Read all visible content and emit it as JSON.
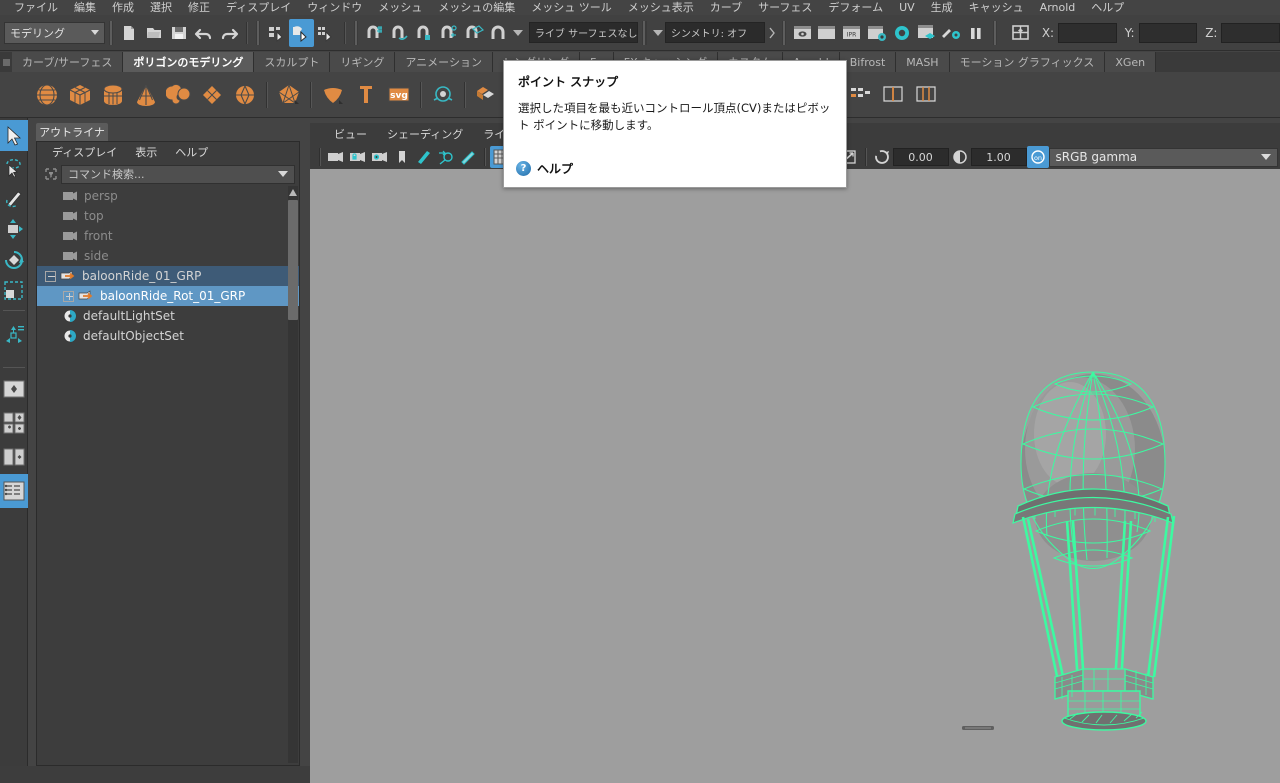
{
  "menubar": {
    "items": [
      "ファイル",
      "編集",
      "作成",
      "選択",
      "修正",
      "ディスプレイ",
      "ウィンドウ",
      "メッシュ",
      "メッシュの編集",
      "メッシュ ツール",
      "メッシュ表示",
      "カーブ",
      "サーフェス",
      "デフォーム",
      "UV",
      "生成",
      "キャッシュ",
      "Arnold",
      "ヘルプ"
    ]
  },
  "statusline": {
    "mode": "モデリング",
    "live_surface": "ライブ サーフェスなし",
    "symmetry": "シンメトリ: オフ",
    "axis_x_label": "X:",
    "axis_y_label": "Y:",
    "axis_z_label": "Z:",
    "axis_x_value": "",
    "axis_y_value": "",
    "axis_z_value": "",
    "icons": [
      "new-scene-icon",
      "open-scene-icon",
      "save-scene-icon",
      "undo-icon",
      "redo-icon",
      "select-hierarchy-icon",
      "select-object-icon",
      "select-component-icon",
      "snap-grid-icon",
      "snap-curve-icon",
      "snap-point-icon",
      "snap-projected-center-icon",
      "snap-view-plane-icon",
      "snap-make-live-icon",
      "render-view-icon",
      "render-sequence-icon",
      "ipr-render-icon",
      "render-settings-icon",
      "hypershade-icon",
      "render-setup-icon",
      "light-editor-icon",
      "pause-icon",
      "toggle-selection-mask-icon"
    ]
  },
  "shelf": {
    "tabs": [
      {
        "label": "カーブ/サーフェス",
        "selected": false
      },
      {
        "label": "ポリゴンのモデリング",
        "selected": true
      },
      {
        "label": "スカルプト",
        "selected": false
      },
      {
        "label": "リギング",
        "selected": false
      },
      {
        "label": "アニメーション",
        "selected": false
      },
      {
        "label": "レンダリング",
        "selected": false
      },
      {
        "label": "Fx",
        "selected": false
      },
      {
        "label": "FX キャッシング",
        "selected": false
      },
      {
        "label": "カスタム",
        "selected": false
      },
      {
        "label": "Arnold",
        "selected": false
      },
      {
        "label": "Bifrost",
        "selected": false
      },
      {
        "label": "MASH",
        "selected": false
      },
      {
        "label": "モーション グラフィックス",
        "selected": false
      },
      {
        "label": "XGen",
        "selected": false
      }
    ],
    "icon_color": "#e08b43",
    "items": [
      "poly-sphere-icon",
      "poly-cube-icon",
      "poly-cylinder-icon",
      "poly-cone-icon",
      "poly-torus-icon",
      "poly-plane-icon",
      "poly-disc-icon",
      "poly-platonic-icon",
      "poly-soft-shape-icon",
      "poly-pipe-icon",
      "poly-svg-icon",
      "poly-type-icon",
      "combine-icon",
      "separate-icon",
      "booleans-icon",
      "smooth-icon",
      "mirror-icon",
      "extrude-icon",
      "bevel-icon",
      "bridge-icon",
      "append-icon",
      "multi-cut-icon",
      "target-weld-icon",
      "quad-draw-icon",
      "poly-sculpt-icon",
      "insert-edge-loop-icon",
      "offset-edge-loop-icon",
      "connect-icon"
    ]
  },
  "toolbox": {
    "items": [
      "select-tool",
      "lasso-select-tool",
      "paint-select-tool",
      "move-tool",
      "rotate-tool",
      "scale-tool",
      "last-tool",
      "show-manipulator-tool",
      "layout-single-pane",
      "layout-two-pane",
      "layout-four-pane",
      "layout-persp-outliner",
      "layout-hypergraph"
    ],
    "selected": "select-tool",
    "accent": "#4a9ad4"
  },
  "outliner": {
    "tab_label": "アウトライナ",
    "menus": [
      "ディスプレイ",
      "表示",
      "ヘルプ"
    ],
    "search_placeholder": "コマンド検索...",
    "search_icon": "filter-icon",
    "rows": [
      {
        "label": "persp",
        "icon": "camera-icon",
        "indent": 1,
        "state": "dim"
      },
      {
        "label": "top",
        "icon": "camera-icon",
        "indent": 1,
        "state": "dim"
      },
      {
        "label": "front",
        "icon": "camera-icon",
        "indent": 1,
        "state": "dim"
      },
      {
        "label": "side",
        "icon": "camera-icon",
        "indent": 1,
        "state": "dim"
      },
      {
        "label": "baloonRide_01_GRP",
        "icon": "group-icon",
        "indent": 0,
        "state": "sel-dark",
        "expander": "minus"
      },
      {
        "label": "baloonRide_Rot_01_GRP",
        "icon": "group-icon",
        "indent": 1,
        "state": "sel-light",
        "expander": "plus"
      },
      {
        "label": "defaultLightSet",
        "icon": "set-icon",
        "indent": 1,
        "state": "normal"
      },
      {
        "label": "defaultObjectSet",
        "icon": "set-icon",
        "indent": 1,
        "state": "normal"
      }
    ]
  },
  "viewport": {
    "menus": [
      "ビュー",
      "シェーディング",
      "ライティング"
    ],
    "toolbar_icons": [
      "select-camera-icon",
      "lock-camera-icon",
      "camera-attributes-icon",
      "bookmark-icon",
      "image-plane-icon",
      "grid-toggle-icon",
      "two-d-pan-zoom-icon",
      "isolate-select-icon",
      "grid-display-icon",
      "film-gate-icon"
    ],
    "grid_active": true,
    "right_icons": [
      "marquee-select-icon",
      "xray-icon",
      "xray-joints-icon",
      "xray-active-icon",
      "exposure-icon",
      "gamma-icon",
      "color-management-icon"
    ],
    "exposure_value": "0.00",
    "gamma_value": "1.00",
    "color_profile": "sRGB gamma",
    "background_color": "#9e9e9e",
    "wireframe_color": "#3dfaa1",
    "model_name": "hot-air-balloon"
  },
  "tooltip": {
    "title": "ポイント スナップ",
    "body": "選択した項目を最も近いコントロール頂点(CV)またはピボット ポイントに移動します。",
    "help_label": "ヘルプ",
    "help_icon": "help-circle-icon"
  }
}
